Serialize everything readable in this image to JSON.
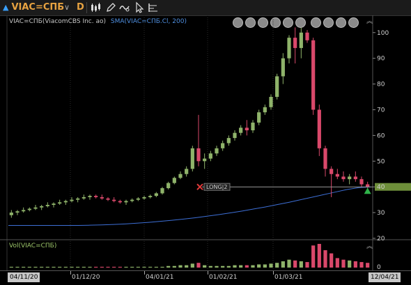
{
  "toolbar": {
    "ticker": "VIAC=СПБ",
    "interval": "D",
    "icons": [
      "candlestick-type-icon",
      "draw-pencil-icon",
      "indicator-icon",
      "cursor-icon",
      "settings-bars-icon"
    ]
  },
  "legend": {
    "symbol": "VIAC=СПБ(ViacomCBS Inc. ao)",
    "sma": "SMA(VIAC=СПБ.Cl, 200)"
  },
  "nav_icons": [
    "rewind-fast-icon",
    "rewind-icon",
    "play-icon",
    "forward-fast-icon",
    "zoom-in-icon",
    "zoom-out-icon",
    "zoom-reset-icon",
    "move-icon",
    "move-vertical-icon",
    "fit-icon"
  ],
  "colors": {
    "up": "#8fb36a",
    "down": "#d9486a",
    "sma": "#3d6fd6",
    "hline": "#9a9a9a",
    "price_badge": "#6e8f3a",
    "long_marker": "#e03a3a"
  },
  "price_axis": {
    "ticks": [
      "100",
      "90",
      "80",
      "70",
      "60",
      "50",
      "40",
      "30",
      "20"
    ],
    "current_price": "40"
  },
  "marker": {
    "label": "LONG|2"
  },
  "volume": {
    "legend": "Vol(VIAC=СПБ)",
    "ticks": [
      "0"
    ]
  },
  "dates": {
    "start": "04/11/20",
    "labels": [
      "01/12/20",
      "04/01/21",
      "01/02/21",
      "01/03/21"
    ],
    "end": "12/04/21"
  },
  "chart_data": {
    "type": "candlestick",
    "ylim": [
      20,
      104
    ],
    "candles": [
      [
        29,
        31,
        28,
        30
      ],
      [
        30,
        31,
        29,
        30.5
      ],
      [
        30.5,
        32,
        30,
        31
      ],
      [
        31,
        32,
        30.5,
        31.5
      ],
      [
        31.5,
        33,
        31,
        32
      ],
      [
        32,
        33,
        31,
        32.5
      ],
      [
        32.5,
        34,
        32,
        33
      ],
      [
        33,
        34,
        32,
        33.5
      ],
      [
        33.5,
        35,
        33,
        34
      ],
      [
        34,
        35,
        33,
        34.5
      ],
      [
        34.5,
        36,
        34,
        35
      ],
      [
        35,
        36,
        34,
        35.5
      ],
      [
        35.5,
        37,
        35,
        36
      ],
      [
        36,
        37,
        35,
        36.5
      ],
      [
        36.5,
        37,
        35.5,
        36
      ],
      [
        36,
        37,
        35,
        35.5
      ],
      [
        35.5,
        36,
        34.5,
        35
      ],
      [
        35,
        36,
        34,
        34.5
      ],
      [
        34.5,
        35,
        33.5,
        34
      ],
      [
        34,
        35,
        33,
        34.5
      ],
      [
        34.5,
        35.5,
        34,
        35
      ],
      [
        35,
        36,
        34.5,
        35.5
      ],
      [
        35.5,
        36.5,
        35,
        36
      ],
      [
        36,
        37,
        35.5,
        36.5
      ],
      [
        36.5,
        38,
        36,
        37.5
      ],
      [
        37.5,
        40,
        37,
        39.5
      ],
      [
        39.5,
        42,
        39,
        41.5
      ],
      [
        41.5,
        44,
        41,
        43.5
      ],
      [
        43.5,
        46,
        43,
        45
      ],
      [
        45,
        48,
        44,
        47
      ],
      [
        47,
        56,
        46,
        55
      ],
      [
        55,
        68,
        48,
        50
      ],
      [
        50,
        53,
        47,
        51
      ],
      [
        51,
        54,
        50,
        53
      ],
      [
        53,
        56,
        52,
        55
      ],
      [
        55,
        58,
        54,
        57
      ],
      [
        57,
        60,
        56,
        59
      ],
      [
        59,
        62,
        58,
        61
      ],
      [
        61,
        64,
        60,
        63
      ],
      [
        63,
        66,
        60,
        62
      ],
      [
        62,
        66,
        61,
        65
      ],
      [
        65,
        70,
        64,
        69
      ],
      [
        69,
        72,
        68,
        71
      ],
      [
        71,
        76,
        70,
        75
      ],
      [
        75,
        84,
        74,
        83
      ],
      [
        83,
        92,
        80,
        90
      ],
      [
        90,
        99,
        88,
        98
      ],
      [
        98,
        102,
        88,
        94
      ],
      [
        94,
        102,
        90,
        100
      ],
      [
        100,
        101,
        96,
        97
      ],
      [
        97,
        98,
        68,
        70
      ],
      [
        70,
        72,
        52,
        55
      ],
      [
        55,
        56,
        44,
        47
      ],
      [
        47,
        48,
        36,
        45
      ],
      [
        45,
        47,
        43,
        44
      ],
      [
        44,
        46,
        42,
        43
      ],
      [
        43,
        45,
        41,
        44
      ],
      [
        44,
        46,
        42,
        43
      ],
      [
        43,
        44,
        40,
        41
      ],
      [
        41,
        42,
        39,
        40
      ]
    ],
    "sma_200": [
      25,
      25,
      25,
      25,
      25,
      25,
      25,
      25.1,
      25.2,
      25.4,
      25.6,
      25.9,
      26.2,
      26.6,
      27,
      27.5,
      28,
      28.6,
      29.2,
      29.9,
      30.6,
      31.4,
      32.2,
      33.1,
      34,
      35,
      36,
      37,
      38,
      39,
      39.7,
      40
    ],
    "volume": [
      1,
      1,
      1,
      1,
      1,
      1,
      1,
      1,
      1,
      1,
      1,
      1,
      1,
      1,
      1,
      1,
      1,
      1,
      1,
      1,
      1,
      1,
      1,
      1,
      1,
      1,
      2,
      2,
      3,
      3,
      5,
      6,
      3,
      2,
      2,
      2,
      2,
      3,
      3,
      3,
      3,
      4,
      4,
      5,
      6,
      8,
      10,
      9,
      8,
      7,
      28,
      30,
      22,
      18,
      12,
      10,
      9,
      8,
      7,
      6
    ]
  }
}
